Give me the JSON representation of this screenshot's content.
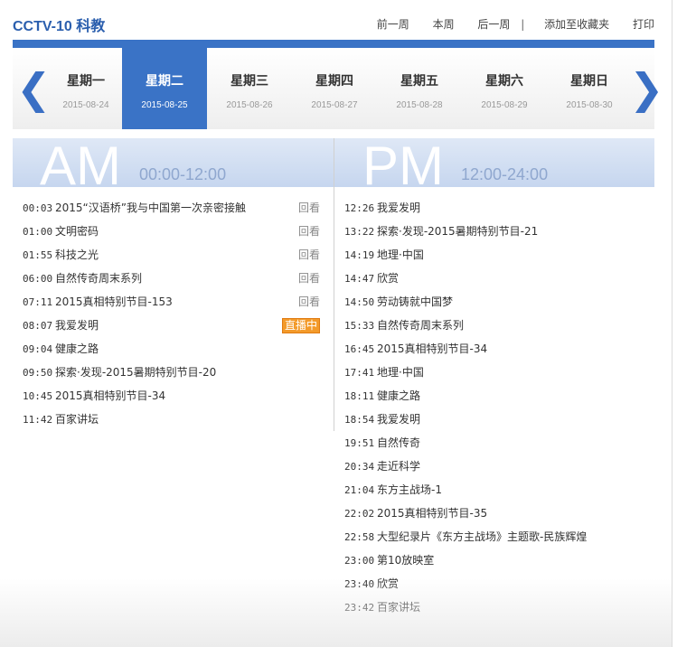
{
  "header": {
    "channel_title": "CCTV-10 科教",
    "links": [
      "前一周",
      "本周",
      "后一周",
      "|",
      "添加至收藏夹",
      "打印"
    ]
  },
  "days": [
    {
      "name": "星期一",
      "date": "2015-08-24",
      "active": false
    },
    {
      "name": "星期二",
      "date": "2015-08-25",
      "active": true
    },
    {
      "name": "星期三",
      "date": "2015-08-26",
      "active": false
    },
    {
      "name": "星期四",
      "date": "2015-08-27",
      "active": false
    },
    {
      "name": "星期五",
      "date": "2015-08-28",
      "active": false
    },
    {
      "name": "星期六",
      "date": "2015-08-29",
      "active": false
    },
    {
      "name": "星期日",
      "date": "2015-08-30",
      "active": false
    }
  ],
  "icons": {
    "prev": "chevron-left-icon",
    "next": "chevron-right-icon"
  },
  "am": {
    "label": "AM",
    "range": "00:00-12:00",
    "programs": [
      {
        "time": "00:03",
        "title": "2015“汉语桥”我与中国第一次亲密接触",
        "tag": "回看"
      },
      {
        "time": "01:00",
        "title": "文明密码",
        "tag": "回看"
      },
      {
        "time": "01:55",
        "title": "科技之光",
        "tag": "回看"
      },
      {
        "time": "06:00",
        "title": "自然传奇周末系列",
        "tag": "回看"
      },
      {
        "time": "07:11",
        "title": "2015真相特别节目-153",
        "tag": "回看"
      },
      {
        "time": "08:07",
        "title": "我爱发明",
        "tag": "直播中"
      },
      {
        "time": "09:04",
        "title": "健康之路",
        "tag": ""
      },
      {
        "time": "09:50",
        "title": "探索·发现-2015暑期特别节目-20",
        "tag": ""
      },
      {
        "time": "10:45",
        "title": "2015真相特别节目-34",
        "tag": ""
      },
      {
        "time": "11:42",
        "title": "百家讲坛",
        "tag": ""
      }
    ]
  },
  "pm": {
    "label": "PM",
    "range": "12:00-24:00",
    "programs": [
      {
        "time": "12:26",
        "title": "我爱发明"
      },
      {
        "time": "13:22",
        "title": "探索·发现-2015暑期特别节目-21"
      },
      {
        "time": "14:19",
        "title": "地理·中国"
      },
      {
        "time": "14:47",
        "title": "欣赏"
      },
      {
        "time": "14:50",
        "title": "劳动铸就中国梦"
      },
      {
        "time": "15:33",
        "title": "自然传奇周末系列"
      },
      {
        "time": "16:45",
        "title": "2015真相特别节目-34"
      },
      {
        "time": "17:41",
        "title": "地理·中国"
      },
      {
        "time": "18:11",
        "title": "健康之路"
      },
      {
        "time": "18:54",
        "title": "我爱发明"
      },
      {
        "time": "19:51",
        "title": "自然传奇"
      },
      {
        "time": "20:34",
        "title": "走近科学"
      },
      {
        "time": "21:04",
        "title": "东方主战场-1"
      },
      {
        "time": "22:02",
        "title": "2015真相特别节目-35"
      },
      {
        "time": "22:58",
        "title": "大型纪录片《东方主战场》主题歌-民族辉煌"
      },
      {
        "time": "23:00",
        "title": "第10放映室"
      },
      {
        "time": "23:40",
        "title": "欣赏"
      },
      {
        "time": "23:42",
        "title": "百家讲坛"
      }
    ]
  },
  "colors": {
    "accent": "#3a73c6",
    "live_badge": "#f39a2a"
  }
}
